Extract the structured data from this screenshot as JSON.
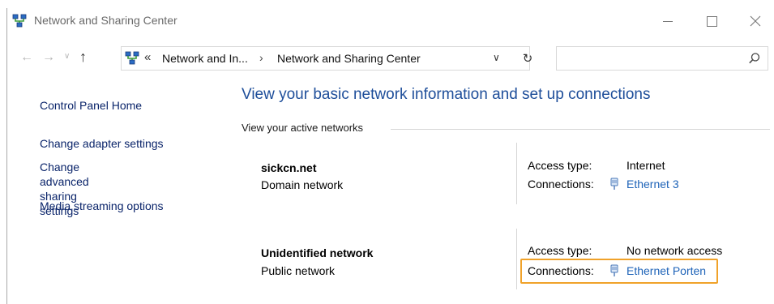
{
  "window": {
    "title": "Network and Sharing Center"
  },
  "icons": {
    "app": "network-icon",
    "minimize": "minimize-icon",
    "maximize": "maximize-icon",
    "close": "close-icon",
    "back": "arrow-left-icon",
    "forward": "arrow-right-icon",
    "recent": "chevron-down-icon",
    "up": "arrow-up-icon",
    "refresh": "refresh-icon",
    "search": "search-icon",
    "connection": "ethernet-icon"
  },
  "nav": {
    "back_glyph": "←",
    "forward_glyph": "→",
    "recent_glyph": "∨",
    "up_glyph": "↑",
    "overflow_glyph": "«",
    "breadcrumbs": [
      "Network and In...",
      "Network and Sharing Center"
    ],
    "separator": "›",
    "dropdown_glyph": "∨",
    "refresh_glyph": "↻",
    "search_value": "",
    "search_placeholder": ""
  },
  "sidebar": {
    "home": "Control Panel Home",
    "links": [
      "Change adapter settings",
      "Change advanced sharing\nsettings",
      "Media streaming options"
    ]
  },
  "main": {
    "heading": "View your basic network information and set up connections",
    "section_label": "View your active networks",
    "access_type_label": "Access type:",
    "connections_label": "Connections:",
    "networks": [
      {
        "name": "sickcn.net",
        "type": "Domain network",
        "access_type": "Internet",
        "connection": "Ethernet 3"
      },
      {
        "name": "Unidentified network",
        "type": "Public network",
        "access_type": "No network access",
        "connection": "Ethernet Porten"
      }
    ]
  },
  "colors": {
    "link": "#1e63b8",
    "heading": "#1e4e9a",
    "highlight": "#f0a22a"
  }
}
